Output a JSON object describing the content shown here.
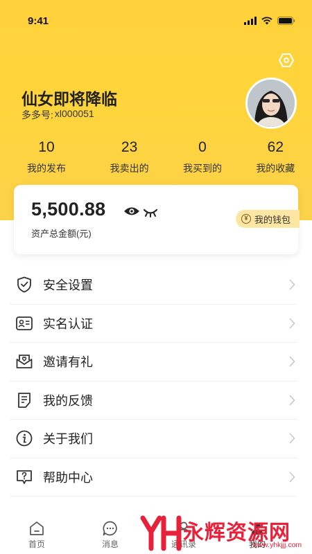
{
  "status_bar": {
    "time": "9:41"
  },
  "profile": {
    "name": "仙女即将降临",
    "id_label": "多多号:",
    "id_value": "xl000051"
  },
  "stats": [
    {
      "value": "10",
      "label": "我的发布"
    },
    {
      "value": "23",
      "label": "我卖出的"
    },
    {
      "value": "0",
      "label": "我买到的"
    },
    {
      "value": "62",
      "label": "我的收藏"
    }
  ],
  "wallet": {
    "balance": "5,500.88",
    "balance_label": "资产总金额(元)",
    "button_label": "我的钱包",
    "button_icon": "yen-icon",
    "yen_symbol": "¥"
  },
  "menu": [
    {
      "label": "安全设置",
      "icon": "shield-icon"
    },
    {
      "label": "实名认证",
      "icon": "id-card-icon"
    },
    {
      "label": "邀请有礼",
      "icon": "invite-envelope-icon"
    },
    {
      "label": "我的反馈",
      "icon": "feedback-icon"
    },
    {
      "label": "关于我们",
      "icon": "info-icon"
    },
    {
      "label": "帮助中心",
      "icon": "help-icon"
    }
  ],
  "tab_bar": [
    {
      "label": "首页",
      "icon": "home-icon"
    },
    {
      "label": "消息",
      "icon": "message-icon"
    },
    {
      "label": "通讯录",
      "icon": "contacts-icon"
    },
    {
      "label": "我的",
      "icon": "profile-icon",
      "active": true
    }
  ],
  "watermark": {
    "brand": "永辉资源网",
    "url": "www.yhkjjj.com"
  },
  "colors": {
    "accent": "#ffd23c",
    "wallet_badge": "#fde6a2",
    "watermark": "#e8213a"
  }
}
